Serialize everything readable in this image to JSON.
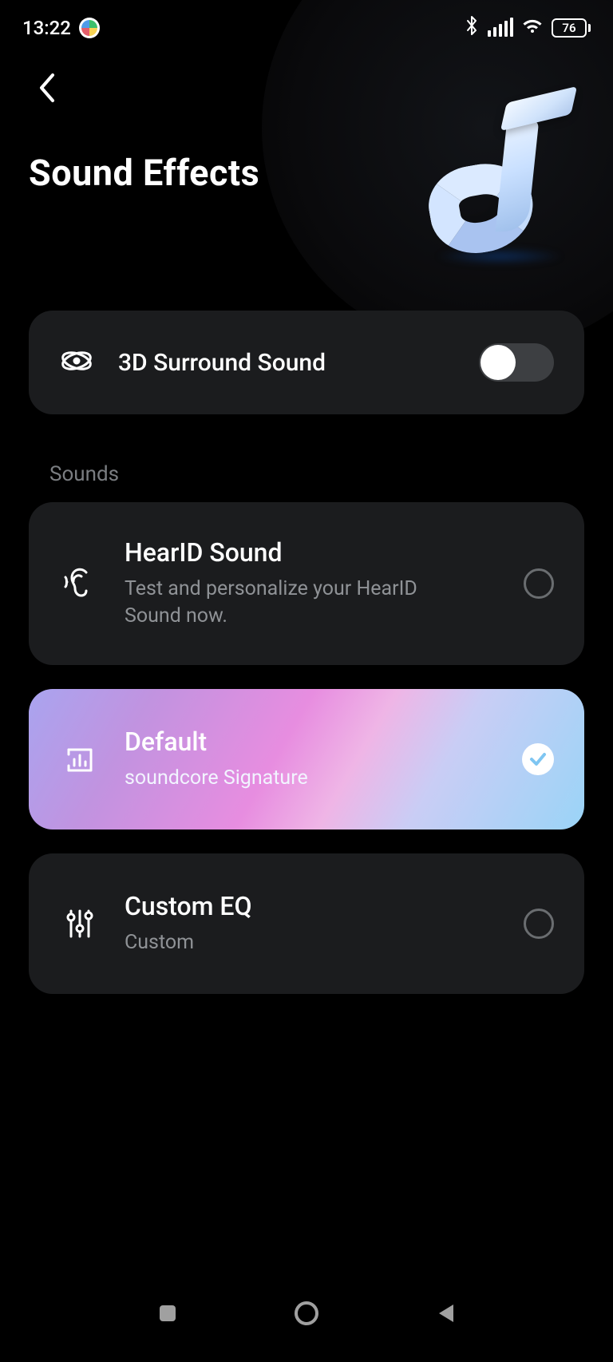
{
  "status": {
    "time": "13:22",
    "battery": "76"
  },
  "page": {
    "title": "Sound Effects"
  },
  "surround": {
    "label": "3D Surround Sound",
    "on": false
  },
  "section": {
    "sounds_label": "Sounds"
  },
  "options": {
    "hearid": {
      "title": "HearID Sound",
      "subtitle": "Test and personalize your HearID Sound now.",
      "selected": false
    },
    "default": {
      "title": "Default",
      "subtitle": "soundcore Signature",
      "selected": true
    },
    "custom": {
      "title": "Custom EQ",
      "subtitle": "Custom",
      "selected": false
    }
  }
}
